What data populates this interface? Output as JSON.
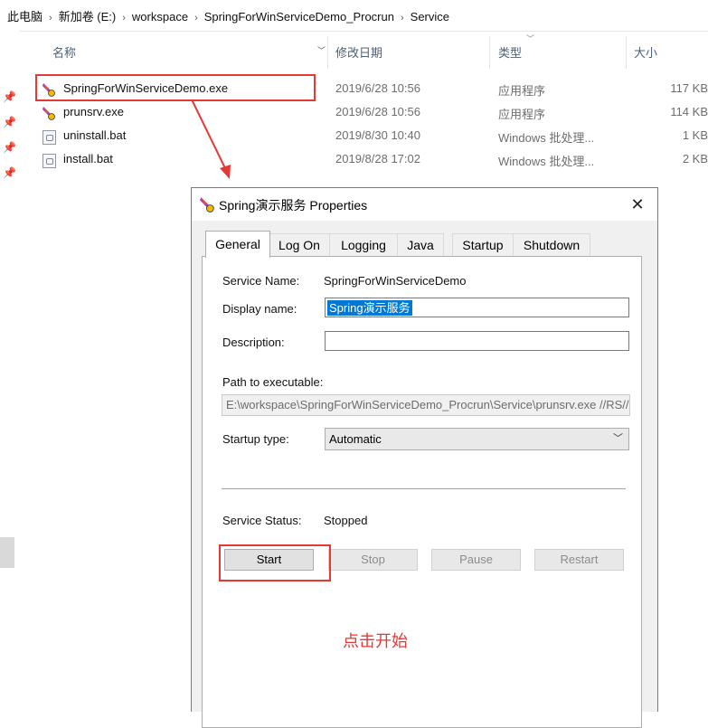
{
  "breadcrumb": [
    "此电脑",
    "新加卷 (E:)",
    "workspace",
    "SpringForWinServiceDemo_Procrun",
    "Service"
  ],
  "breadcrumb_sep": "›",
  "columns": {
    "name": "名称",
    "date": "修改日期",
    "type": "类型",
    "size": "大小"
  },
  "files": [
    {
      "name": "SpringForWinServiceDemo.exe",
      "date": "2019/6/28 10:56",
      "type": "应用程序",
      "size": "117 KB",
      "icon": "feather-exe-icon"
    },
    {
      "name": "prunsrv.exe",
      "date": "2019/6/28 10:56",
      "type": "应用程序",
      "size": "114 KB",
      "icon": "feather-exe-icon"
    },
    {
      "name": "uninstall.bat",
      "date": "2019/8/30 10:40",
      "type": "Windows 批处理...",
      "size": "1 KB",
      "icon": "batch-file-icon"
    },
    {
      "name": "install.bat",
      "date": "2019/8/28 17:02",
      "type": "Windows 批处理...",
      "size": "2 KB",
      "icon": "batch-file-icon"
    }
  ],
  "dialog": {
    "title": "Spring演示服务 Properties",
    "close": "✕",
    "tabs": [
      "General",
      "Log On",
      "Logging",
      "Java",
      "Startup",
      "Shutdown"
    ],
    "active_tab": "General",
    "service_name_label": "Service Name:",
    "service_name": "SpringForWinServiceDemo",
    "display_name_label": "Display name:",
    "display_name": "Spring演示服务",
    "description_label": "Description:",
    "description": "",
    "path_label": "Path to executable:",
    "path": "E:\\workspace\\SpringForWinServiceDemo_Procrun\\Service\\prunsrv.exe //RS//SpringForWinServiceDemo",
    "startup_type_label": "Startup type:",
    "startup_type": "Automatic",
    "status_label": "Service Status:",
    "status": "Stopped",
    "buttons": {
      "start": "Start",
      "stop": "Stop",
      "pause": "Pause",
      "restart": "Restart"
    }
  },
  "annotation": "点击开始",
  "colors": {
    "accent": "#0078d7",
    "callout": "#e53935",
    "header_text": "#4c607a"
  }
}
